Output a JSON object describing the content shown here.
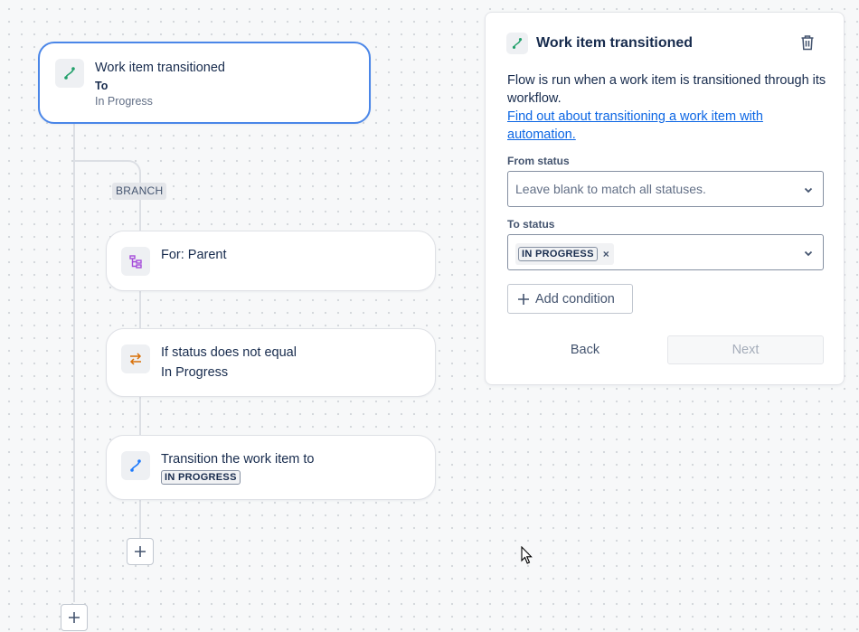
{
  "flow": {
    "trigger": {
      "title": "Work item transitioned",
      "sub_label": "To",
      "sub_value": "In Progress"
    },
    "branch_tag": "BRANCH",
    "branch_card": {
      "title": "For: Parent"
    },
    "condition_card": {
      "title": "If status does not equal",
      "value": "In Progress"
    },
    "action_card": {
      "title": "Transition the work item to",
      "lozenge": "IN PROGRESS"
    }
  },
  "panel": {
    "title": "Work item transitioned",
    "description": "Flow is run when a work item is transitioned through its workflow.",
    "link_text": "Find out about transitioning a work item with automation.",
    "from_status": {
      "label": "From status",
      "placeholder": "Leave blank to match all statuses."
    },
    "to_status": {
      "label": "To status",
      "selected_tag": "IN PROGRESS",
      "remove_glyph": "×"
    },
    "add_condition_label": "Add condition",
    "back_label": "Back",
    "next_label": "Next"
  },
  "icons": {
    "trigger": "transition-icon",
    "branch": "branch-tree-icon",
    "condition": "swap-arrows-icon",
    "action": "transition-icon",
    "delete": "trash-icon",
    "dropdown": "chevron-down-icon",
    "add": "plus-icon",
    "cursor": "mouse-pointer-icon"
  },
  "colors": {
    "accent_blue": "#4a86e8",
    "link": "#0c66e4",
    "trigger_icon": "#22a06b",
    "branch_icon": "#a54cd9",
    "condition_icon": "#d97008",
    "action_icon": "#1d7afc"
  }
}
